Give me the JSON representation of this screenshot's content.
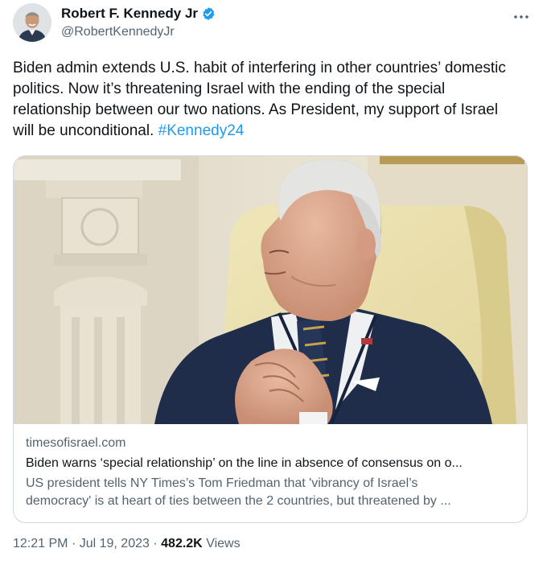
{
  "author": {
    "name": "Robert F. Kennedy Jr",
    "handle": "@RobertKennedyJr",
    "avatar_icon": "person-avatar",
    "verified_icon": "verified-badge-icon",
    "verified_color": "#1d9bf0"
  },
  "more_icon": "more-options-icon",
  "tweet": {
    "text_line_1": "Biden admin extends U.S. habit of interfering in other countries’ domestic",
    "text_line_2": "politics. Now it’s threatening Israel with the ending of the special",
    "text_line_3": "relationship between our two nations. As President, my support of Israel",
    "text_line_4": "will be unconditional.",
    "hashtag": "#Kennedy24"
  },
  "card": {
    "domain": "timesofisrael.com",
    "title": "Biden warns ‘special relationship’ on the line in absence of consensus on o...",
    "desc_line_1": "US president tells NY Times’s Tom Friedman that 'vibrancy of Israel’s",
    "desc_line_2": "democracy' is at heart of ties between the 2 countries, but threatened by ..."
  },
  "footer": {
    "time": "12:21 PM",
    "date": "Jul 19, 2023",
    "views_count": "482.2K",
    "views_label": "Views"
  }
}
